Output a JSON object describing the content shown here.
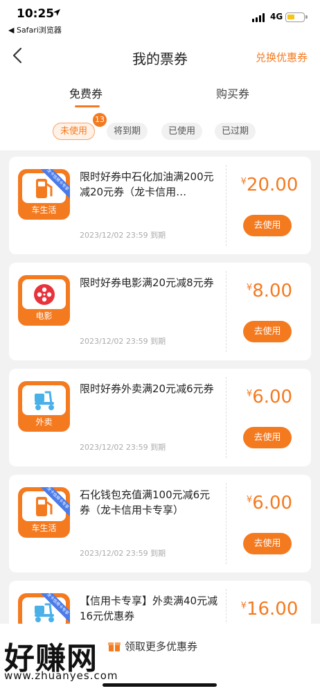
{
  "status_bar": {
    "time": "10:25",
    "back_app": "◀ Safari浏览器",
    "network": "4G"
  },
  "nav": {
    "title": "我的票券",
    "action": "兑换优惠券"
  },
  "tabs": [
    {
      "label": "免费券",
      "active": true
    },
    {
      "label": "购买券",
      "active": false
    }
  ],
  "filters": [
    {
      "label": "未使用",
      "active": true
    },
    {
      "label": "将到期",
      "active": false
    },
    {
      "label": "已使用",
      "active": false
    },
    {
      "label": "已过期",
      "active": false
    }
  ],
  "filter_badge": "13",
  "coupons": [
    {
      "title": "限时好券中石化加油满200元减20元券（龙卡信用…",
      "expiry": "2023/12/02 23:59 到期",
      "currency": "¥",
      "amount": "20.00",
      "button": "去使用",
      "icon": "gas-pump-icon",
      "icon_label": "车生活",
      "ribbon": "龙卡信用卡专享"
    },
    {
      "title": "限时好券电影满20元减8元券",
      "expiry": "2023/12/02 23:59 到期",
      "currency": "¥",
      "amount": "8.00",
      "button": "去使用",
      "icon": "film-reel-icon",
      "icon_label": "电影",
      "ribbon": ""
    },
    {
      "title": "限时好券外卖满20元减6元券",
      "expiry": "2023/12/02 23:59 到期",
      "currency": "¥",
      "amount": "6.00",
      "button": "去使用",
      "icon": "scooter-icon",
      "icon_label": "外卖",
      "ribbon": ""
    },
    {
      "title": "石化钱包充值满100元减6元券（龙卡信用卡专享）",
      "expiry": "2023/12/02 23:59 到期",
      "currency": "¥",
      "amount": "6.00",
      "button": "去使用",
      "icon": "gas-pump-icon",
      "icon_label": "车生活",
      "ribbon": "龙卡信用卡专享"
    },
    {
      "title": "【信用卡专享】外卖满40元减16元优惠券",
      "expiry": "",
      "currency": "¥",
      "amount": "16.00",
      "button": "",
      "icon": "scooter-icon",
      "icon_label": "",
      "ribbon": "龙卡信用卡专享"
    }
  ],
  "bottom": {
    "more_link": "领取更多优惠券",
    "watermark": "好赚网",
    "watermark_url": "www.zhuanyes.com"
  },
  "colors": {
    "accent": "#f47a20",
    "background": "#f2f2f2",
    "icon_blue": "#4ab0e8"
  }
}
